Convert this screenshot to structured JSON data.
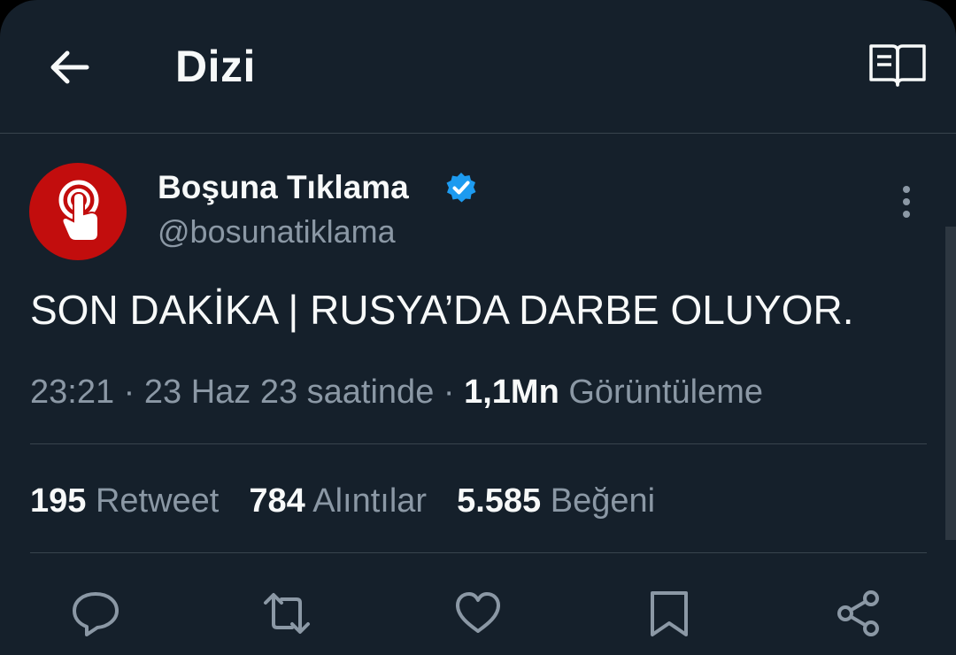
{
  "header": {
    "title": "Dizi",
    "back_icon": "arrow-left-icon",
    "reader_icon": "reader-mode-icon"
  },
  "tweet": {
    "author": {
      "name": "Boşuna Tıklama",
      "handle": "@bosunatiklama",
      "avatar_icon": "tap-finger-icon",
      "avatar_color": "#c20d0d",
      "verified": true,
      "verified_color": "#1d9bf0"
    },
    "text": "SON DAKİKA | RUSYA’DA DARBE OLUYOR.",
    "meta": {
      "time": "23:21",
      "sep1": " · ",
      "date": "23 Haz 23 saatinde",
      "sep2": " · ",
      "views": "1,1Mn",
      "views_label": " Görüntüleme"
    },
    "stats": [
      {
        "count": "195",
        "label": " Retweet"
      },
      {
        "count": "784",
        "label": " Alıntılar"
      },
      {
        "count": "5.585",
        "label": " Beğeni"
      }
    ],
    "actions": [
      "reply-icon",
      "retweet-icon",
      "like-icon",
      "bookmark-icon",
      "share-icon"
    ]
  },
  "colors": {
    "background": "#15202b",
    "text_primary": "#f7f9f9",
    "text_secondary": "#8b98a5",
    "divider": "#38444d"
  }
}
